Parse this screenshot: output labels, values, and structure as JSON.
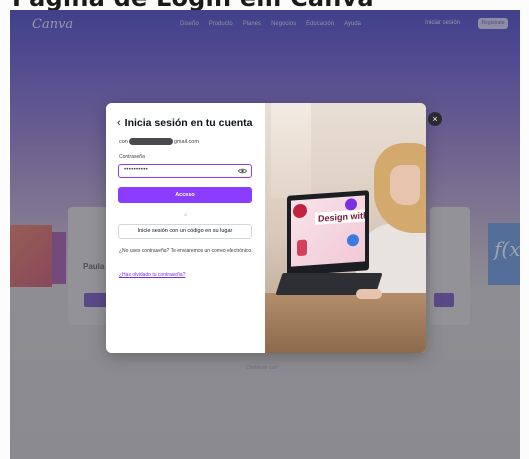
{
  "page": {
    "heading": "Página de Login em Canva"
  },
  "navbar": {
    "logo": "Canva",
    "items": [
      "Diseño",
      "Producto",
      "Planes",
      "Negocios",
      "Educación",
      "Ayuda"
    ],
    "login": "Iniciar sesión",
    "signup": "Regístrate"
  },
  "background": {
    "card_label": "Paula",
    "right_tile_text": "f(x",
    "footer_text": "Continuar con"
  },
  "modal": {
    "back_glyph": "‹",
    "title": "Inicia sesión en tu cuenta",
    "email_prefix": "con",
    "email_suffix": "gmail.com",
    "password_label": "Contraseña",
    "password_value": "••••••••••",
    "submit_label": "Acceso",
    "or_text": "o",
    "code_button_label": "Inicie sesión con un código en su lugar",
    "hint_text": "¿No uses contraseña? Te enviaremos un correo electrónico.",
    "forgot_link": "¿Has olvidado tu contraseña?",
    "close_glyph": "×",
    "illustration_text": "Design with ease"
  },
  "colors": {
    "accent": "#8b3dff",
    "text": "#0e1318",
    "overlay": "#2a2a30"
  }
}
